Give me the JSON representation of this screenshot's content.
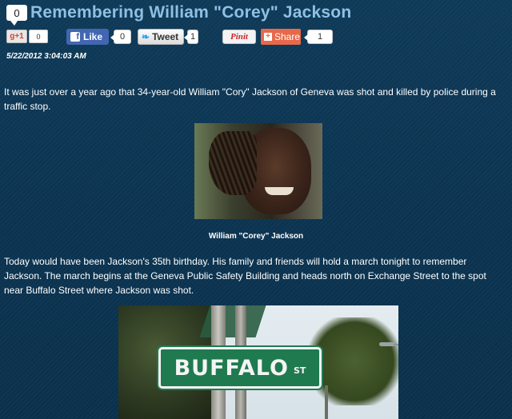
{
  "article": {
    "comment_count": "0",
    "title": "Remembering William \"Corey\" Jackson",
    "date": "5/22/2012 3:04:03 AM",
    "paragraph1": "It was just over a year ago that 34-year-old William \"Cory\" Jackson of Geneva was shot and killed by police during a traffic stop.",
    "photo_caption": "William \"Corey\" Jackson",
    "paragraph2": "Today would have been Jackson's 35th birthday.  His family and friends will hold a march tonight to remember Jackson.  The march begins at the Geneva Public Safety Building and heads north on Exchange Street to the spot near Buffalo Street where Jackson was shot.",
    "sign_name": "BUFFALO",
    "sign_suffix": "ST"
  },
  "share_bar": {
    "gplus_label": "g+1",
    "gplus_count": "0",
    "facebook_label": "Like",
    "facebook_count": "0",
    "twitter_label": "Tweet",
    "twitter_count": "1",
    "pinterest_label": "Pinit",
    "share_label": "Share",
    "share_count": "1"
  },
  "colors": {
    "title": "#8ec0e4",
    "background": "#0e3a58",
    "facebook": "#4266b2",
    "share": "#e8694a",
    "sign_green": "#1f7a4f"
  },
  "icons": [
    "comment-icon",
    "facebook-icon",
    "twitter-bird-icon",
    "share-plus-icon"
  ]
}
